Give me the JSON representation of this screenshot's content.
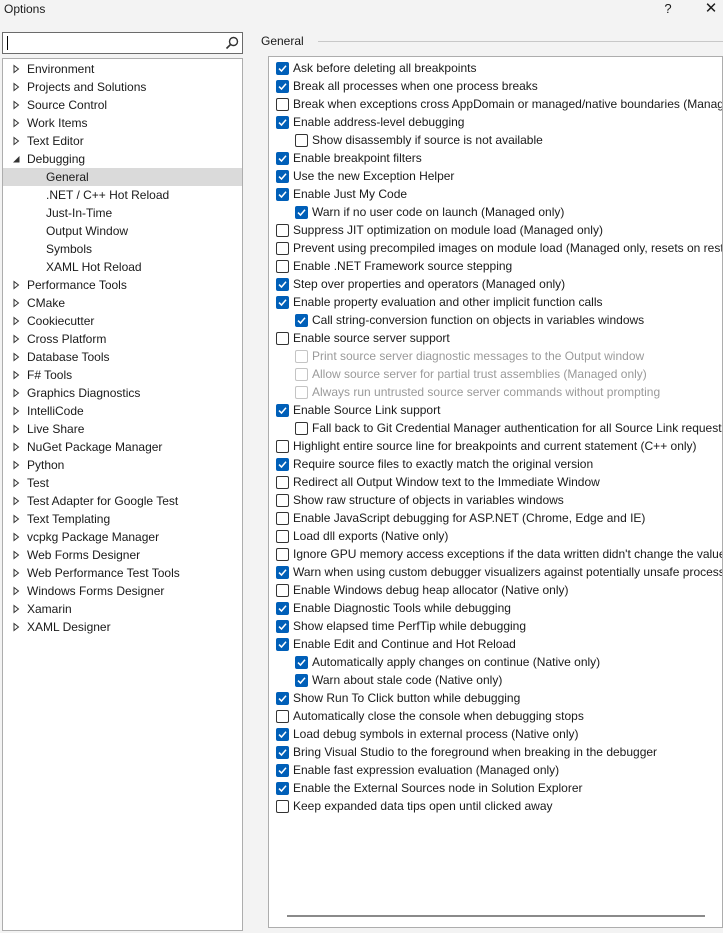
{
  "window": {
    "title": "Options",
    "help": "?",
    "close": "✕"
  },
  "search": {
    "value": "",
    "placeholder": ""
  },
  "tree": [
    {
      "label": "Environment",
      "expanded": false,
      "level": 0
    },
    {
      "label": "Projects and Solutions",
      "expanded": false,
      "level": 0
    },
    {
      "label": "Source Control",
      "expanded": false,
      "level": 0
    },
    {
      "label": "Work Items",
      "expanded": false,
      "level": 0
    },
    {
      "label": "Text Editor",
      "expanded": false,
      "level": 0
    },
    {
      "label": "Debugging",
      "expanded": true,
      "level": 0
    },
    {
      "label": "General",
      "level": 1,
      "selected": true
    },
    {
      "label": ".NET / C++ Hot Reload",
      "level": 1
    },
    {
      "label": "Just-In-Time",
      "level": 1
    },
    {
      "label": "Output Window",
      "level": 1
    },
    {
      "label": "Symbols",
      "level": 1
    },
    {
      "label": "XAML Hot Reload",
      "level": 1
    },
    {
      "label": "Performance Tools",
      "expanded": false,
      "level": 0
    },
    {
      "label": "CMake",
      "expanded": false,
      "level": 0
    },
    {
      "label": "Cookiecutter",
      "expanded": false,
      "level": 0
    },
    {
      "label": "Cross Platform",
      "expanded": false,
      "level": 0
    },
    {
      "label": "Database Tools",
      "expanded": false,
      "level": 0
    },
    {
      "label": "F# Tools",
      "expanded": false,
      "level": 0
    },
    {
      "label": "Graphics Diagnostics",
      "expanded": false,
      "level": 0
    },
    {
      "label": "IntelliCode",
      "expanded": false,
      "level": 0
    },
    {
      "label": "Live Share",
      "expanded": false,
      "level": 0
    },
    {
      "label": "NuGet Package Manager",
      "expanded": false,
      "level": 0
    },
    {
      "label": "Python",
      "expanded": false,
      "level": 0
    },
    {
      "label": "Test",
      "expanded": false,
      "level": 0
    },
    {
      "label": "Test Adapter for Google Test",
      "expanded": false,
      "level": 0
    },
    {
      "label": "Text Templating",
      "expanded": false,
      "level": 0
    },
    {
      "label": "vcpkg Package Manager",
      "expanded": false,
      "level": 0
    },
    {
      "label": "Web Forms Designer",
      "expanded": false,
      "level": 0
    },
    {
      "label": "Web Performance Test Tools",
      "expanded": false,
      "level": 0
    },
    {
      "label": "Windows Forms Designer",
      "expanded": false,
      "level": 0
    },
    {
      "label": "Xamarin",
      "expanded": false,
      "level": 0
    },
    {
      "label": "XAML Designer",
      "expanded": false,
      "level": 0
    }
  ],
  "section": {
    "title": "General"
  },
  "options": [
    {
      "label": "Ask before deleting all breakpoints",
      "checked": true,
      "level": 0
    },
    {
      "label": "Break all processes when one process breaks",
      "checked": true,
      "level": 0
    },
    {
      "label": "Break when exceptions cross AppDomain or managed/native boundaries (Managed only)",
      "checked": false,
      "level": 0
    },
    {
      "label": "Enable address-level debugging",
      "checked": true,
      "level": 0
    },
    {
      "label": "Show disassembly if source is not available",
      "checked": false,
      "level": 1
    },
    {
      "label": "Enable breakpoint filters",
      "checked": true,
      "level": 0
    },
    {
      "label": "Use the new Exception Helper",
      "checked": true,
      "level": 0
    },
    {
      "label": "Enable Just My Code",
      "checked": true,
      "level": 0
    },
    {
      "label": "Warn if no user code on launch (Managed only)",
      "checked": true,
      "level": 1
    },
    {
      "label": "Suppress JIT optimization on module load (Managed only)",
      "checked": false,
      "level": 0
    },
    {
      "label": "Prevent using precompiled images on module load (Managed only, resets on restart)",
      "checked": false,
      "level": 0
    },
    {
      "label": "Enable .NET Framework source stepping",
      "checked": false,
      "level": 0
    },
    {
      "label": "Step over properties and operators (Managed only)",
      "checked": true,
      "level": 0
    },
    {
      "label": "Enable property evaluation and other implicit function calls",
      "checked": true,
      "level": 0
    },
    {
      "label": "Call string-conversion function on objects in variables windows",
      "checked": true,
      "level": 1
    },
    {
      "label": "Enable source server support",
      "checked": false,
      "level": 0
    },
    {
      "label": "Print source server diagnostic messages to the Output window",
      "checked": false,
      "level": 1,
      "disabled": true
    },
    {
      "label": "Allow source server for partial trust assemblies (Managed only)",
      "checked": false,
      "level": 1,
      "disabled": true
    },
    {
      "label": "Always run untrusted source server commands without prompting",
      "checked": false,
      "level": 1,
      "disabled": true
    },
    {
      "label": "Enable Source Link support",
      "checked": true,
      "level": 0
    },
    {
      "label": "Fall back to Git Credential Manager authentication for all Source Link requests",
      "checked": false,
      "level": 1
    },
    {
      "label": "Highlight entire source line for breakpoints and current statement (C++ only)",
      "checked": false,
      "level": 0
    },
    {
      "label": "Require source files to exactly match the original version",
      "checked": true,
      "level": 0
    },
    {
      "label": "Redirect all Output Window text to the Immediate Window",
      "checked": false,
      "level": 0
    },
    {
      "label": "Show raw structure of objects in variables windows",
      "checked": false,
      "level": 0
    },
    {
      "label": "Enable JavaScript debugging for ASP.NET (Chrome, Edge and IE)",
      "checked": false,
      "level": 0
    },
    {
      "label": "Load dll exports (Native only)",
      "checked": false,
      "level": 0
    },
    {
      "label": "Ignore GPU memory access exceptions if the data written didn't change the value",
      "checked": false,
      "level": 0
    },
    {
      "label": "Warn when using custom debugger visualizers against potentially unsafe processes",
      "checked": true,
      "level": 0
    },
    {
      "label": "Enable Windows debug heap allocator (Native only)",
      "checked": false,
      "level": 0
    },
    {
      "label": "Enable Diagnostic Tools while debugging",
      "checked": true,
      "level": 0
    },
    {
      "label": "Show elapsed time PerfTip while debugging",
      "checked": true,
      "level": 0
    },
    {
      "label": "Enable Edit and Continue and Hot Reload",
      "checked": true,
      "level": 0
    },
    {
      "label": "Automatically apply changes on continue (Native only)",
      "checked": true,
      "level": 1
    },
    {
      "label": "Warn about stale code (Native only)",
      "checked": true,
      "level": 1
    },
    {
      "label": "Show Run To Click button while debugging",
      "checked": true,
      "level": 0
    },
    {
      "label": "Automatically close the console when debugging stops",
      "checked": false,
      "level": 0
    },
    {
      "label": "Load debug symbols in external process (Native only)",
      "checked": true,
      "level": 0
    },
    {
      "label": "Bring Visual Studio to the foreground when breaking in the debugger",
      "checked": true,
      "level": 0
    },
    {
      "label": "Enable fast expression evaluation (Managed only)",
      "checked": true,
      "level": 0
    },
    {
      "label": "Enable the External Sources node in Solution Explorer",
      "checked": true,
      "level": 0
    },
    {
      "label": "Keep expanded data tips open until clicked away",
      "checked": false,
      "level": 0
    }
  ],
  "colors": {
    "accent": "#005fb8",
    "selected_row": "#dadada",
    "disabled_text": "#9a9a9a"
  }
}
